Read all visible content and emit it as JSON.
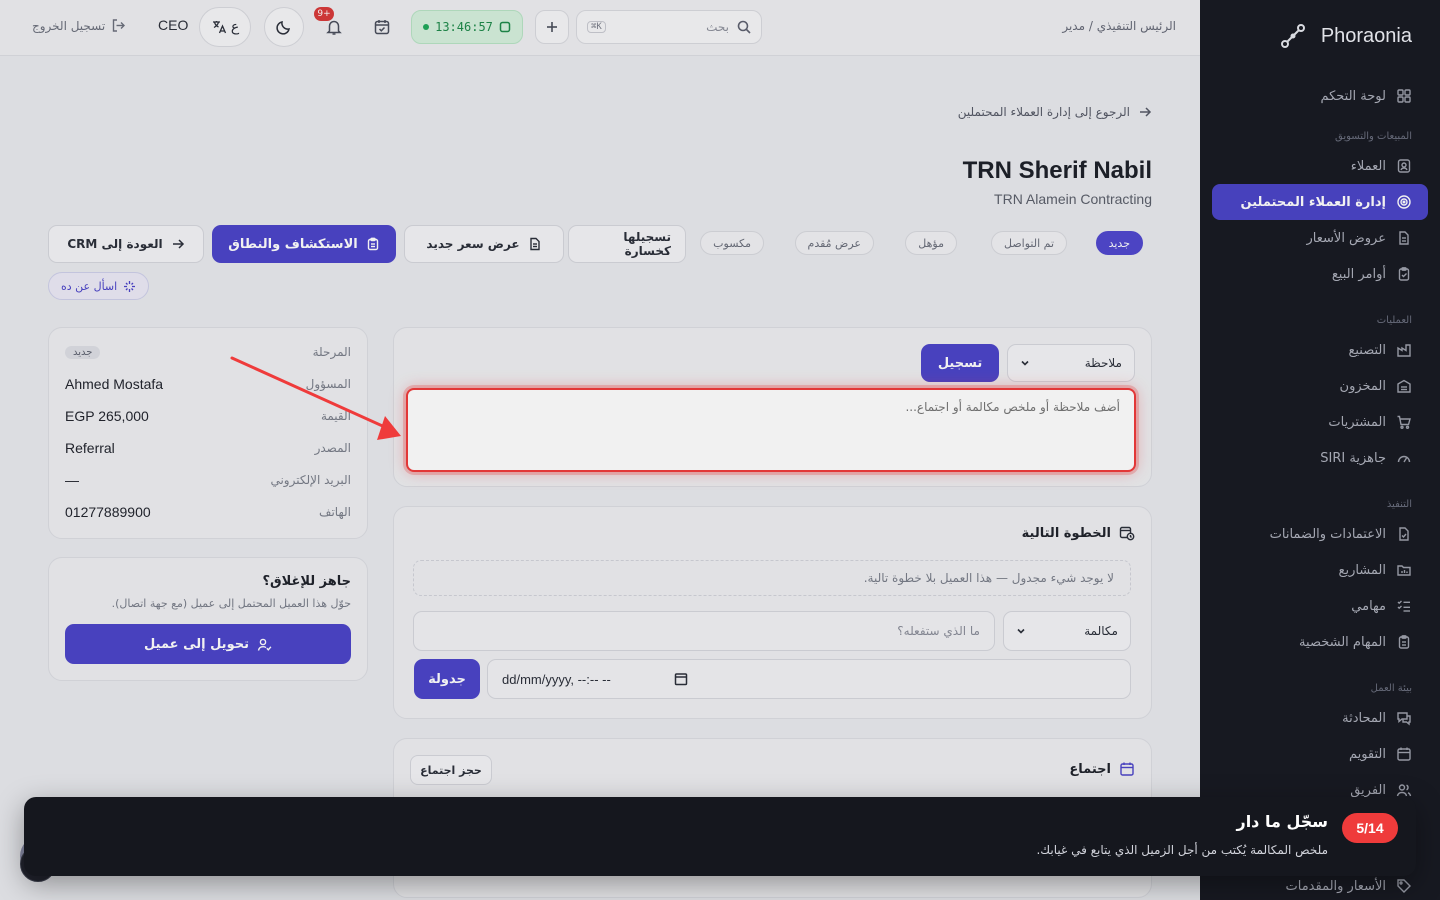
{
  "sidebar": {
    "brand": "Phoraonia",
    "dashboard": "لوحة التحكم",
    "sections": {
      "sales": "المبيعات والتسويق",
      "operations": "العمليات",
      "execution": "التنفيذ",
      "workspace": "بيئة العمل"
    },
    "sales_items": [
      "العملاء",
      "إدارة العملاء المحتملين",
      "عروض الأسعار",
      "أوامر البيع"
    ],
    "operations_items": [
      "التصنيع",
      "المخزون",
      "المشتريات",
      "جاهزية SIRI"
    ],
    "execution_items": [
      "الاعتمادات والضمانات",
      "المشاريع",
      "مهامي",
      "المهام الشخصية"
    ],
    "workspace_items": [
      "المحادثة",
      "التقويم",
      "الفريق",
      "الأسعار والمقدمات"
    ]
  },
  "topbar": {
    "breadcrumb": "الرئيس التنفيذي / مدير",
    "search_placeholder": "بحث",
    "search_shortcut": "K⌘",
    "clock": "13:46:57",
    "notifications_badge": "+9",
    "language_label": "ع",
    "role": "CEO",
    "logout": "تسجيل الخروج"
  },
  "lead": {
    "back_link": "الرجوع إلى إدارة العملاء المحتملين",
    "name": "TRN Sherif Nabil",
    "company": "TRN Alamein Contracting",
    "stages": [
      "جديد",
      "تم التواصل",
      "مؤهل",
      "عرض مُقدم",
      "مكسوب"
    ],
    "current_stage": "جديد",
    "actions": {
      "mark_lost": "تسجيلها كخسارة",
      "new_quote": "عرض سعر جديد",
      "discovery": "الاستكشاف والنطاق",
      "back_crm": "العودة إلى CRM"
    },
    "ask_chip": "اسأل عن ده"
  },
  "info": {
    "rows": [
      {
        "label": "المرحلة",
        "value": "جديد"
      },
      {
        "label": "المسؤول",
        "value": "Ahmed Mostafa"
      },
      {
        "label": "القيمة",
        "value": "EGP 265,000"
      },
      {
        "label": "المصدر",
        "value": "Referral"
      },
      {
        "label": "البريد الإلكتروني",
        "value": "—"
      },
      {
        "label": "الهاتف",
        "value": "01277889900"
      }
    ]
  },
  "close_card": {
    "title": "جاهز للإغلاق؟",
    "subtitle": "حوّل هذا العميل المحتمل إلى عميل (مع جهة اتصال).",
    "button": "تحويل إلى عميل"
  },
  "activity": {
    "type": "ملاحظة",
    "log_button": "تسجيل",
    "placeholder": "أضف ملاحظة أو ملخص مكالمة أو اجتماع..."
  },
  "next_step": {
    "title": "الخطوة التالية",
    "empty": "لا يوجد شيء مجدول — هذا العميل بلا خطوة تالية.",
    "type": "مكالمة",
    "what_placeholder": "ما الذي ستفعله؟",
    "datetime_placeholder": "dd/mm/yyyy, --:-- --",
    "schedule_button": "جدولة"
  },
  "meeting": {
    "title": "اجتماع",
    "book_button": "حجز اجتماع"
  },
  "tour": {
    "counter": "5/14",
    "title": "سجّل ما دار",
    "description": "ملخص المكالمة يُكتب من أجل الزميل الذي يتابع في غيابك."
  },
  "colors": {
    "accent": "#4c45c9",
    "highlight": "#f03a3a",
    "sidebar_bg": "#181a22",
    "clock_green": "#1e8a4a"
  }
}
